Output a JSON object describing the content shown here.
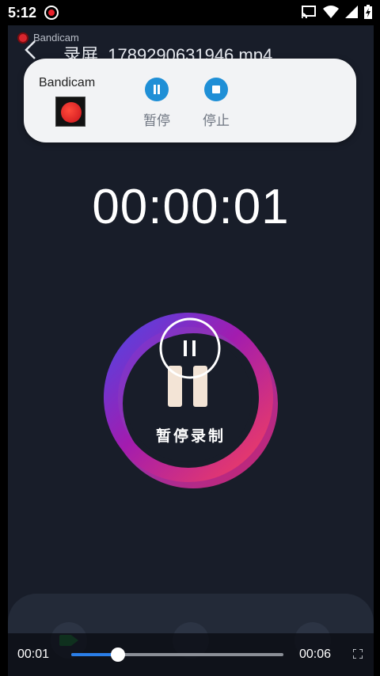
{
  "status_bar": {
    "time": "5:12",
    "icons": [
      "record-indicator-icon",
      "cast-icon",
      "wifi-icon",
      "signal-icon",
      "battery-charging-icon"
    ]
  },
  "header": {
    "app_small_label": "Bandicam",
    "file_title": "录屏_1789290631946.mp4"
  },
  "notification": {
    "app_name": "Bandicam",
    "pause_label": "暂停",
    "stop_label": "停止",
    "accent": "#1f8fd6"
  },
  "recorder": {
    "timer": "00:00:01",
    "button_label": "暂停录制",
    "ring_colors": [
      "#4f46e5",
      "#a21caf",
      "#f43f5e"
    ]
  },
  "bottom_panel": {
    "icons": [
      "video-camera-icon",
      "grid-icon",
      "refresh-icon"
    ],
    "camera_color": "#21b04b"
  },
  "player": {
    "position": "00:01",
    "duration": "00:06",
    "progress": 0.22,
    "accent": "#2a7ee8"
  }
}
